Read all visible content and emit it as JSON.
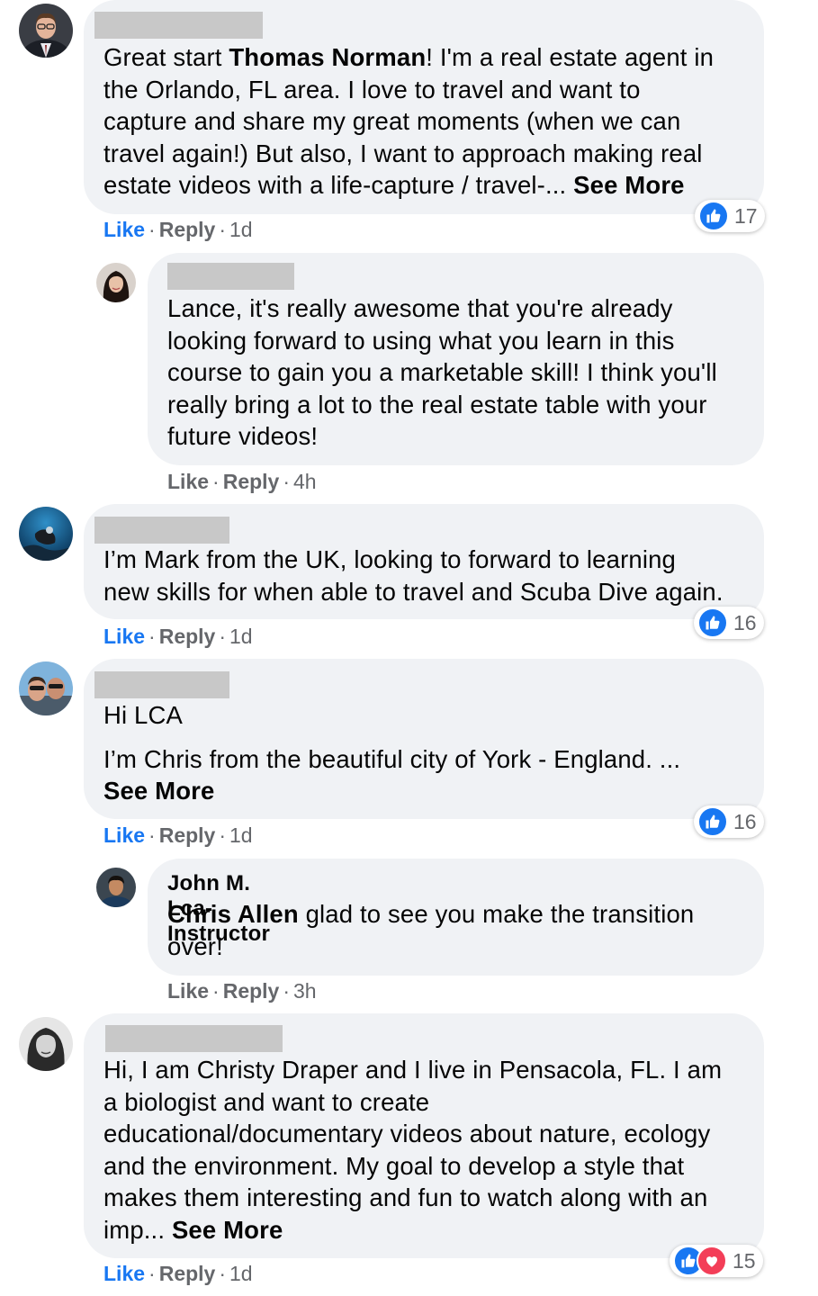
{
  "actions": {
    "like": "Like",
    "reply": "Reply",
    "sep": "·"
  },
  "comments": [
    {
      "id": "c1",
      "lines": [
        [
          {
            "t": "Great start "
          },
          {
            "t": "Thomas Norman",
            "b": true
          },
          {
            "t": "! I'm a real estate agent in"
          }
        ],
        [
          {
            "t": "the Orlando, FL area. I love to travel and want to"
          }
        ],
        [
          {
            "t": "capture and share my great moments (when we can"
          }
        ],
        [
          {
            "t": "travel again!) But also, I want to approach making real"
          }
        ],
        [
          {
            "t": "estate videos with a life-capture / travel-... "
          },
          {
            "t": "See More",
            "b": true
          }
        ]
      ],
      "time": "1d",
      "like_active": true,
      "reactions": {
        "count": "17",
        "types": [
          "like"
        ]
      }
    },
    {
      "id": "c2",
      "lines": [
        [
          {
            "t": "Lance, it's really awesome that you're already"
          }
        ],
        [
          {
            "t": "looking forward to using what you learn in this"
          }
        ],
        [
          {
            "t": "course to gain you a marketable skill! I think you'll"
          }
        ],
        [
          {
            "t": "really bring a lot to the real estate table with your"
          }
        ],
        [
          {
            "t": "future videos!"
          }
        ]
      ],
      "time": "4h",
      "like_active": false
    },
    {
      "id": "c3",
      "lines": [
        [
          {
            "t": "I’m Mark from the UK, looking to forward to learning"
          }
        ],
        [
          {
            "t": "new skills for when able to travel and Scuba Dive again."
          }
        ]
      ],
      "time": "1d",
      "like_active": true,
      "reactions": {
        "count": "16",
        "types": [
          "like"
        ]
      }
    },
    {
      "id": "c4",
      "lines": [
        [
          {
            "t": "Hi LCA"
          }
        ],
        [
          {
            "t": "I’m Chris from the beautiful city of York - England. ..."
          }
        ],
        [
          {
            "t": "See More",
            "b": true
          }
        ]
      ],
      "time": "1d",
      "like_active": true,
      "reactions": {
        "count": "16",
        "types": [
          "like"
        ]
      }
    },
    {
      "id": "c5",
      "author": "John M. Lca-Instructor",
      "lines": [
        [
          {
            "t": "Chris Allen",
            "b": true
          },
          {
            "t": " glad to see you make the transition"
          }
        ],
        [
          {
            "t": "over!"
          }
        ]
      ],
      "time": "3h",
      "like_active": false
    },
    {
      "id": "c6",
      "lines": [
        [
          {
            "t": "Hi, I am Christy Draper and I live in Pensacola, FL. I am"
          }
        ],
        [
          {
            "t": "a biologist and want to create"
          }
        ],
        [
          {
            "t": "educational/documentary videos about nature, ecology"
          }
        ],
        [
          {
            "t": "and the environment. My goal to develop a style that"
          }
        ],
        [
          {
            "t": "makes them interesting and fun to watch along with an"
          }
        ],
        [
          {
            "t": "imp... "
          },
          {
            "t": "See More",
            "b": true
          }
        ]
      ],
      "time": "1d",
      "like_active": true,
      "reactions": {
        "count": "15",
        "types": [
          "like",
          "love"
        ]
      }
    }
  ]
}
